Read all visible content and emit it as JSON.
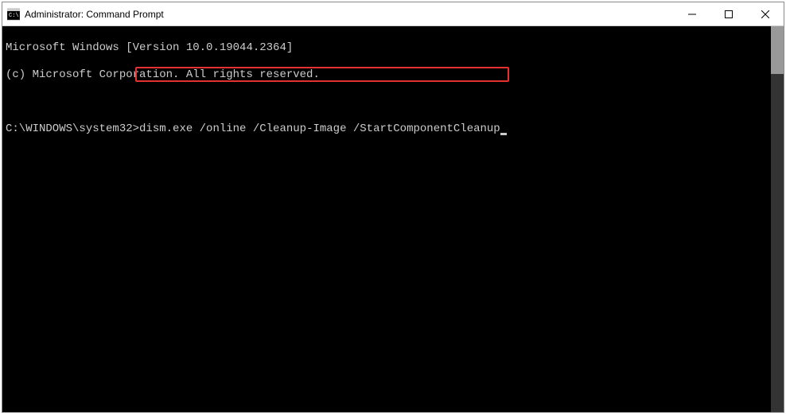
{
  "window": {
    "title": "Administrator: Command Prompt"
  },
  "terminal": {
    "line1": "Microsoft Windows [Version 10.0.19044.2364]",
    "line2": "(c) Microsoft Corporation. All rights reserved.",
    "prompt": "C:\\WINDOWS\\system32>",
    "command": "dism.exe /online /Cleanup-Image /StartComponentCleanup"
  }
}
